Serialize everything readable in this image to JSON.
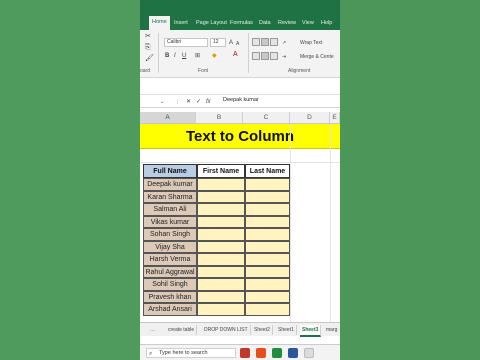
{
  "ribbon": {
    "tabs": [
      "Home",
      "Insert",
      "Page Layout",
      "Formulas",
      "Data",
      "Review",
      "View",
      "Help"
    ],
    "font_name": "Calibri",
    "font_size": "12",
    "wrap_text": "Wrap Text",
    "merge": "Merge & Cente",
    "groups": {
      "clipboard": "oard",
      "font": "Font",
      "alignment": "Alignment"
    }
  },
  "formula_bar": {
    "value": "Deepak kumar"
  },
  "columns": [
    "A",
    "B",
    "C",
    "D",
    "E"
  ],
  "sheet": {
    "title": "Text to Column",
    "headers": [
      "Full Name",
      "First Name",
      "Last Name"
    ],
    "names": [
      "Deepak kumar",
      "Karan Sharma",
      "Salman Ali",
      "Vikas kumar",
      "Sohan Singh",
      "Vijay Sha",
      "Harsh Verma",
      "Rahul Aggrawal",
      "Sohil Singh",
      "Pravesh khan",
      "Arshad Ansari"
    ]
  },
  "sheet_tabs": [
    "create table",
    "DROP DOWN LIST",
    "Sheet2",
    "Sheet1",
    "Sheet3",
    "marg"
  ],
  "taskbar": {
    "search_placeholder": "Type here to search"
  },
  "colors": {
    "excel_green": "#1f7244",
    "title_fill": "#ffff00",
    "name_fill": "#ddc9b7",
    "entry_fill": "#fff3bf"
  }
}
